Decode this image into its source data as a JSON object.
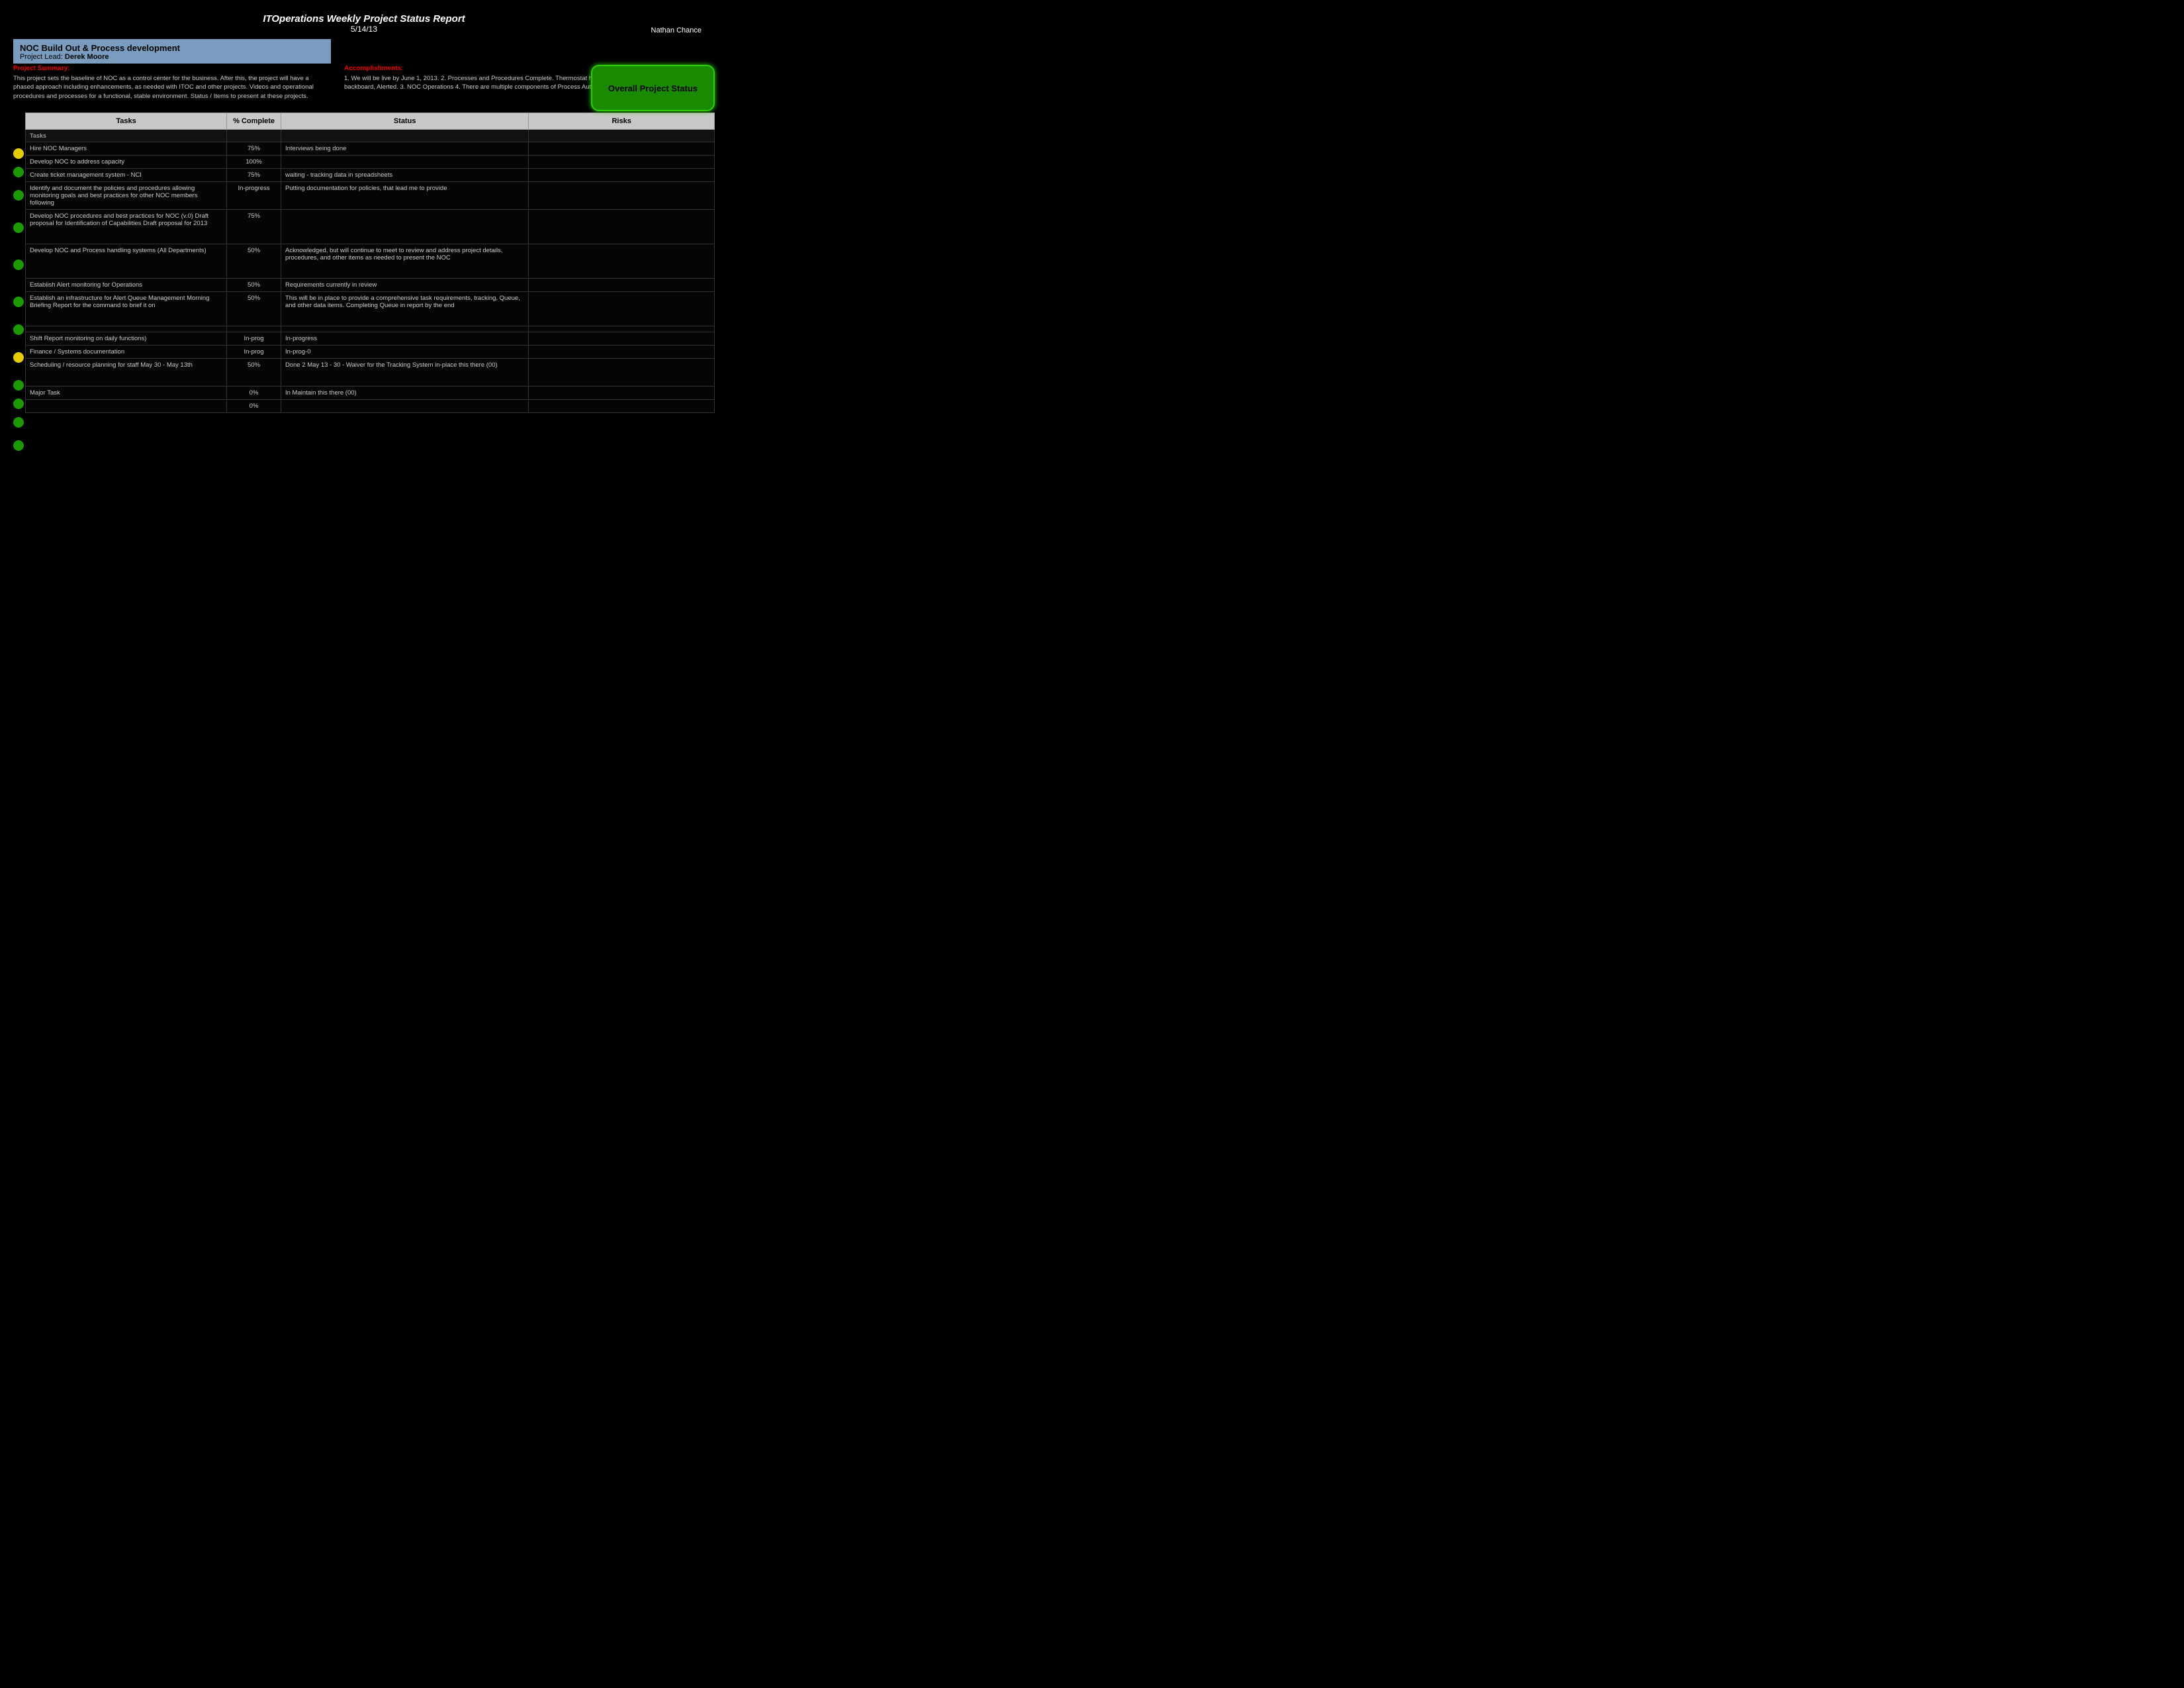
{
  "header": {
    "title": "ITOperations Weekly Project Status Report",
    "date": "5/14/13",
    "right_text": "Nathan Chance"
  },
  "project": {
    "name": "NOC Build Out & Process development",
    "lead_label": "Project Lead:",
    "lead_name": "Derek Moore"
  },
  "project_summary_label": "Project Summary:",
  "project_summary": "This project sets the baseline of NOC as a control center for the business. After this, the project will have a phased approach including enhancements, as needed with ITOC and other projects. Videos and operational procedures and processes for a functional, stable environment. Status / Items to present at these projects.",
  "accomplishments_label": "Accomplishments:",
  "accomplishments": "1. We will be live by June 1, 2013.\n2. Processes and Procedures Complete. Thermostat has been turned back up, and the backboard, Alerted.\n3. NOC Operations\n4. There are multiple components of Process Automation (Finding Control of NOC).",
  "overall_status_label": "Overall Project Status",
  "table": {
    "columns": [
      "Tasks",
      "% Complete",
      "Status",
      "Risks"
    ],
    "rows": [
      {
        "type": "section",
        "task": "Tasks",
        "pct": "",
        "status": "",
        "risks": "",
        "dot": null
      },
      {
        "type": "data",
        "task": "Hire NOC Managers",
        "pct": "75%",
        "status": "Interviews being done",
        "risks": "",
        "dot": "yellow"
      },
      {
        "type": "data",
        "task": "Develop NOC to address capacity",
        "pct": "100%",
        "status": "",
        "risks": "",
        "dot": "green"
      },
      {
        "type": "data",
        "task": "Create ticket management system - NCI",
        "pct": "75%",
        "status": "waiting - tracking data in spreadsheets",
        "risks": "",
        "dot": "green"
      },
      {
        "type": "data",
        "task": "Identify and document the policies and procedures allowing monitoring goals and best practices for other NOC members following",
        "pct": "In-progress",
        "status": "Putting documentation for policies, that lead me to provide",
        "risks": "",
        "dot": "green"
      },
      {
        "type": "data",
        "task": "Develop NOC procedures and best practices for NOC (v.0)\nDraft proposal for Identification of Capabilities\nDraft proposal for 2013",
        "pct": "75%",
        "status": "",
        "risks": "",
        "dot": "green"
      },
      {
        "type": "data",
        "task": "Develop NOC and Process handling systems (All\nDepartments)",
        "pct": "50%",
        "status": "Acknowledged, but will continue to meet to review and address project details, procedures, and other items as needed to present the NOC",
        "risks": "",
        "dot": "green"
      },
      {
        "type": "data",
        "task": "Establish Alert monitoring for Operations",
        "pct": "50%",
        "status": "Requirements currently in review",
        "risks": "",
        "dot": "green"
      },
      {
        "type": "data",
        "task": "Establish an infrastructure for Alert Queue\nManagement\nMorning Briefing Report for the command to brief it on",
        "pct": "50%",
        "status": "This will be in place to provide a comprehensive task requirements, tracking, Queue, and other data items. Completing Queue in report by the end",
        "risks": "",
        "dot": "yellow"
      },
      {
        "type": "data",
        "task": "",
        "pct": "",
        "status": "",
        "risks": "",
        "dot": "green"
      },
      {
        "type": "data",
        "task": "Shift Report monitoring on daily functions)",
        "pct": "In-prog",
        "status": "In-progress",
        "risks": "",
        "dot": "green"
      },
      {
        "type": "data",
        "task": "Finance / Systems documentation",
        "pct": "In-prog",
        "status": "In-prog-0",
        "risks": "",
        "dot": "green"
      },
      {
        "type": "data",
        "task": "Scheduling / resource planning for staff May 30 - May 13th",
        "pct": "50%",
        "status": "Done 2 May 13 - 30 - Waiver for the Tracking System in-place this there (00)",
        "risks": "",
        "dot": "green"
      },
      {
        "type": "data",
        "task": "Major Task",
        "pct": "0%",
        "status": "In Maintain this there (00)",
        "risks": "",
        "dot": ""
      },
      {
        "type": "data",
        "task": "",
        "pct": "0%",
        "status": "",
        "risks": "",
        "dot": ""
      }
    ]
  }
}
